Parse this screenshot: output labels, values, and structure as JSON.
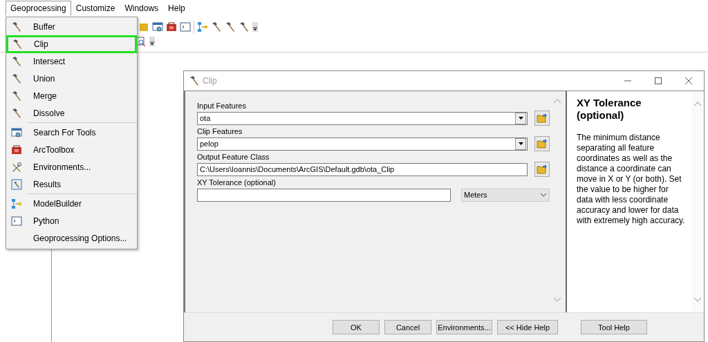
{
  "menu_bar": [
    {
      "label": "Geoprocessing",
      "selected": true
    },
    {
      "label": "Customize",
      "selected": false
    },
    {
      "label": "Windows",
      "selected": false
    },
    {
      "label": "Help",
      "selected": false
    }
  ],
  "menu": {
    "groups": [
      [
        {
          "label": "Buffer",
          "kind": "hammer",
          "selected": false
        },
        {
          "label": "Clip",
          "kind": "hammer",
          "selected": true
        },
        {
          "label": "Intersect",
          "kind": "hammer",
          "selected": false
        },
        {
          "label": "Union",
          "kind": "hammer",
          "selected": false
        },
        {
          "label": "Merge",
          "kind": "hammer",
          "selected": false
        },
        {
          "label": "Dissolve",
          "kind": "hammer",
          "selected": false
        }
      ],
      [
        {
          "label": "Search For Tools",
          "kind": "search",
          "selected": false
        },
        {
          "label": "ArcToolbox",
          "kind": "toolbox",
          "selected": false
        },
        {
          "label": "Environments...",
          "kind": "tools",
          "selected": false
        },
        {
          "label": "Results",
          "kind": "results",
          "selected": false
        }
      ],
      [
        {
          "label": "ModelBuilder",
          "kind": "model",
          "selected": false
        },
        {
          "label": "Python",
          "kind": "python",
          "selected": false
        },
        {
          "label": "Geoprocessing Options...",
          "kind": "plain",
          "selected": false
        }
      ]
    ]
  },
  "dialog": {
    "title": "Clip",
    "parameters": [
      {
        "label": "Input Features",
        "kind": "combo",
        "value": "ota"
      },
      {
        "label": "Clip Features",
        "kind": "combo",
        "value": "pelop"
      },
      {
        "label": "Output Feature Class",
        "kind": "path",
        "value": "C:\\Users\\Ioannis\\Documents\\ArcGIS\\Default.gdb\\ota_Clip"
      },
      {
        "label": "XY Tolerance (optional)",
        "kind": "units",
        "units": "Meters"
      }
    ],
    "help": {
      "title": "XY Tolerance (optional)",
      "body": "The minimum distance separating all feature coordinates as well as the distance a coordinate can move in X or Y (or both). Set the value to be higher for data with less coordinate accuracy and lower for data with extremely high accuracy."
    },
    "buttons": [
      "OK",
      "Cancel",
      "Environments...",
      "<< Hide Help",
      "Tool Help"
    ]
  }
}
